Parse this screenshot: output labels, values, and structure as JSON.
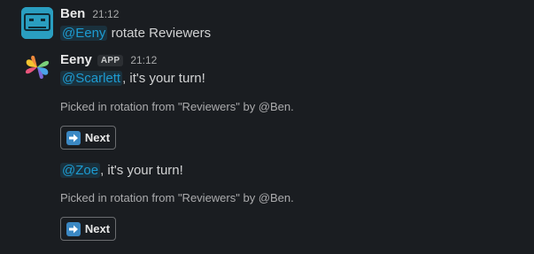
{
  "messages": [
    {
      "author": "Ben",
      "time": "21:12",
      "mention": "@Eeny",
      "text": " rotate Reviewers"
    },
    {
      "author": "Eeny",
      "badge": "APP",
      "time": "21:12",
      "turns": [
        {
          "mention": "@Scarlett",
          "text": ", it's your turn!",
          "context": "Picked in rotation from \"Reviewers\" by @Ben.",
          "button": "Next"
        },
        {
          "mention": "@Zoe",
          "text": ", it's your turn!",
          "context": "Picked in rotation from \"Reviewers\" by @Ben.",
          "button": "Next"
        }
      ]
    }
  ],
  "icons": {
    "ben_avatar": "robot-face-icon",
    "eeny_avatar": "app-logo-icon",
    "button_icon": "right-arrow-icon"
  },
  "colors": {
    "background": "#1a1d21",
    "mention": "#1d9bd1",
    "avatar_ben": "#2a9ec0"
  }
}
